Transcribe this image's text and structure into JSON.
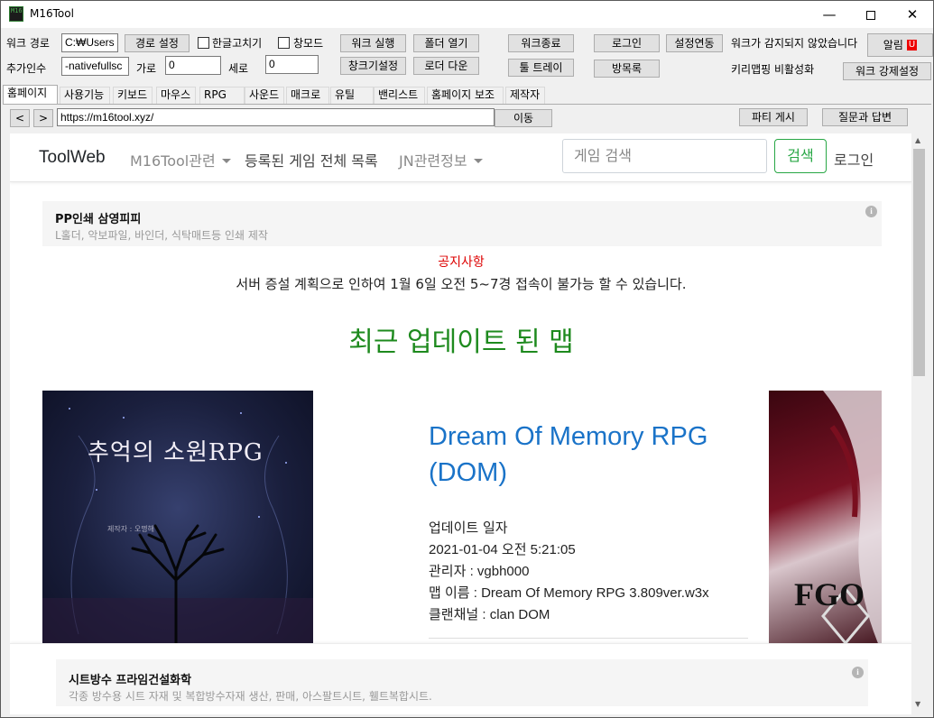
{
  "window": {
    "title": "M16Tool",
    "icon_text": "M16",
    "minimize": "—",
    "close": "✕"
  },
  "toolbar": {
    "work_path_label": "워크 경로",
    "work_path_value": "C:₩Users",
    "path_setting_button": "경로 설정",
    "hangul_fix_label": "한글고치기",
    "window_mode_label": "창모드",
    "work_run_button": "워크 실행",
    "open_folder_button": "폴더 열기",
    "work_exit_button": "워크종료",
    "login_button": "로그인",
    "settings_link_button": "설정연동",
    "work_not_detected_text": "워크가 감지되지 않았습니다",
    "alarm_button": "알림",
    "alarm_badge": "U",
    "extra_args_label": "추가인수",
    "extra_args_value": "-nativefullsc",
    "width_label": "가로",
    "width_value": "0",
    "height_label": "세로",
    "height_value": "0",
    "window_setting_button": "창크기설정",
    "loader_down_button": "로더 다운",
    "tool_tray_button": "툴 트레이",
    "room_list_button": "방목록",
    "keymap_disabled_text": "키리맵핑 비활성화",
    "force_work_setting_button": "워크 강제설정"
  },
  "tabs": [
    {
      "label": "홈페이지"
    },
    {
      "label": "사용기능"
    },
    {
      "label": "키보드"
    },
    {
      "label": "마우스"
    },
    {
      "label": "RPG"
    },
    {
      "label": "사운드"
    },
    {
      "label": "매크로"
    },
    {
      "label": "유틸"
    },
    {
      "label": "밴리스트"
    },
    {
      "label": "홈페이지 보조"
    },
    {
      "label": "제작자"
    }
  ],
  "browser": {
    "back": "<",
    "forward": ">",
    "url": "https://m16tool.xyz/",
    "go_button": "이동",
    "party_board_button": "파티 게시",
    "qna_button": "질문과 답변"
  },
  "site": {
    "brand": "ToolWeb",
    "nav_m16": "M16Tool관련",
    "nav_games": "등록된 게임 전체 목록",
    "nav_jn": "JN관련정보",
    "search_placeholder": "게임 검색",
    "search_button": "검색",
    "login": "로그인",
    "ad1_title": "PP인쇄 삼영피피",
    "ad1_desc": "L홀더, 악보파일, 바인더, 식탁매트등 인쇄 제작",
    "notice_title": "공지사항",
    "notice_body": "서버 증설 계획으로 인하여 1월 6일 오전 5~7경 접속이 불가능 할 수 있습니다.",
    "recent_title": "최근 업데이트 된 맵",
    "cover_title": "추억의 소원RPG",
    "cover_author": "제작자 : 오명해",
    "cover2_text": "FGO",
    "map_title": "Dream Of Memory RPG (DOM)",
    "update_label": "업데이트 일자",
    "update_value": "2021-01-04 오전 5:21:05",
    "admin": "관리자 : vgbh000",
    "map_name": "맵 이름 : Dream Of Memory RPG 3.809ver.w3x",
    "clan": "클랜채널 : clan DOM",
    "ad2_title": "시트방수 프라임건설화학",
    "ad2_desc": "각종 방수용 시트 자재 및 복합방수자재 생산, 판매, 아스팔트시트, 휄트복합시트."
  }
}
